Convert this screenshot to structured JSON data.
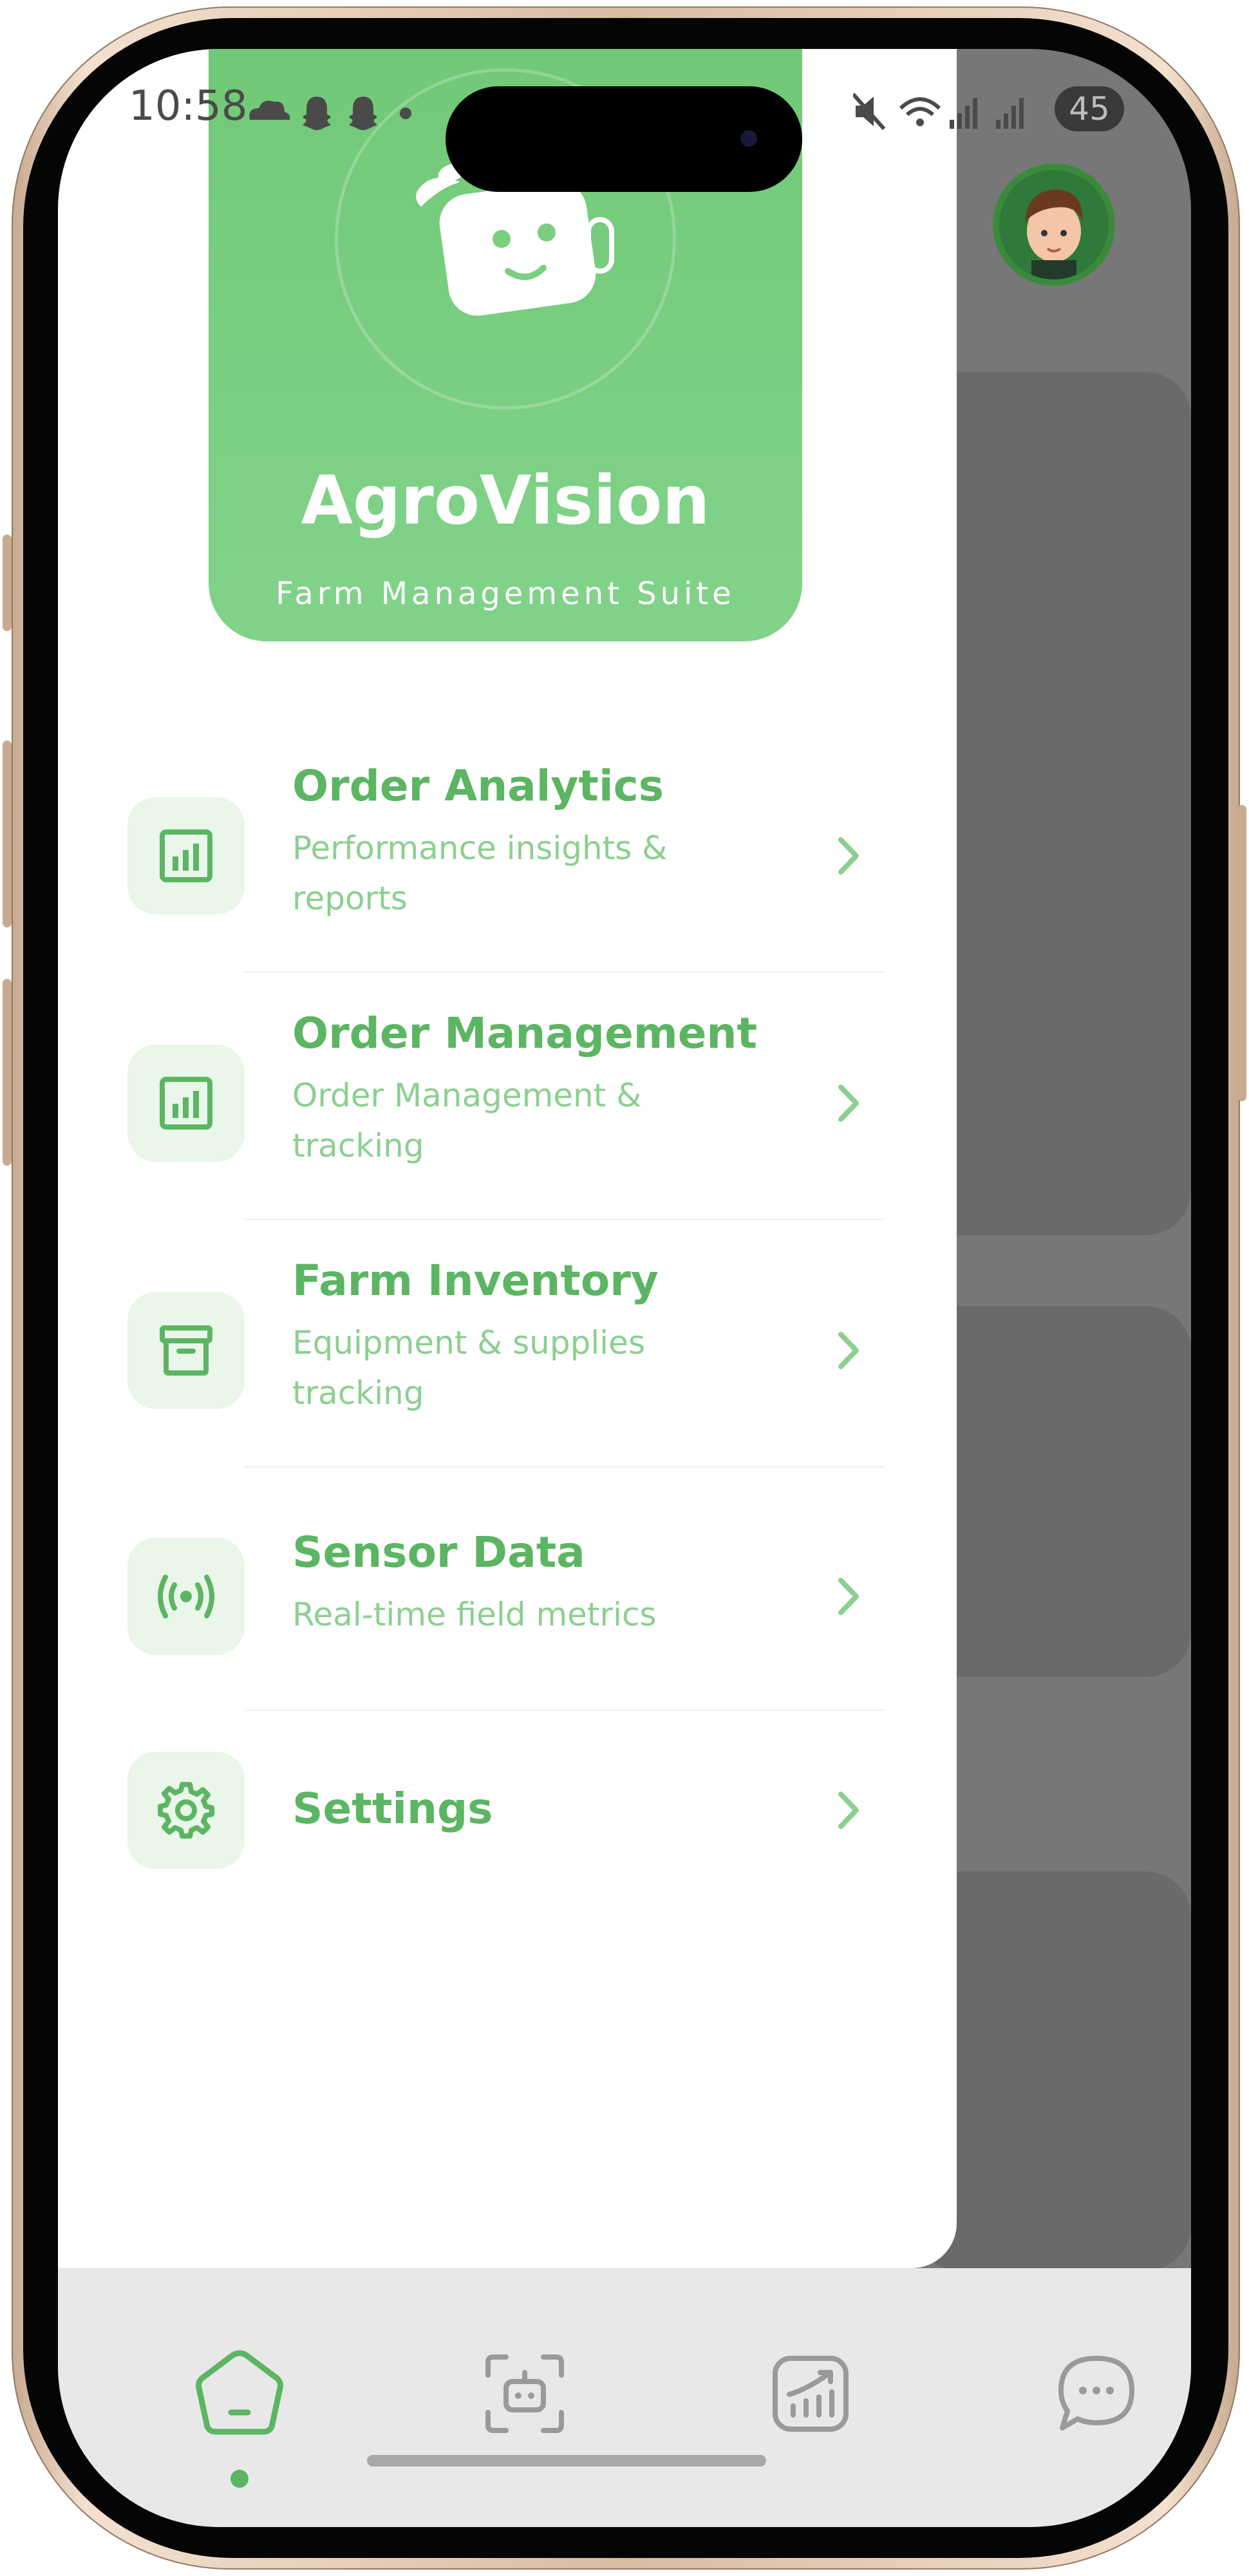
{
  "status_bar": {
    "time": "10:58",
    "battery": "45",
    "icons": [
      "cloud-icon",
      "snapchat-icon",
      "snapchat-icon",
      "dot-icon",
      "mute-icon",
      "wifi-icon",
      "signal-icon",
      "signal-icon"
    ]
  },
  "brand": {
    "title": "AgroVision",
    "subtitle": "Farm Management Suite",
    "logo_icon": "robot-leaf-icon"
  },
  "menu": {
    "items": [
      {
        "title": "Order Analytics",
        "desc_line1": "Performance insights &",
        "desc_line2": "reports",
        "icon": "bar-chart-icon"
      },
      {
        "title": "Order Management",
        "desc_line1": "Order Management &",
        "desc_line2": "tracking",
        "icon": "bar-chart-icon"
      },
      {
        "title": "Farm Inventory",
        "desc_line1": "Equipment & supplies",
        "desc_line2": "tracking",
        "icon": "archive-box-icon"
      },
      {
        "title": "Sensor Data",
        "desc_line1": "Real-time field metrics",
        "desc_line2": "",
        "icon": "broadcast-icon"
      },
      {
        "title": "Settings",
        "desc_line1": "",
        "desc_line2": "",
        "icon": "gear-icon"
      }
    ]
  },
  "bottom_nav": {
    "items": [
      {
        "name": "home",
        "icon": "home-icon",
        "active": true
      },
      {
        "name": "scan-bot",
        "icon": "scan-robot-icon",
        "active": false
      },
      {
        "name": "analytics",
        "icon": "chart-up-icon",
        "active": false
      },
      {
        "name": "chat",
        "icon": "chat-bubble-icon",
        "active": false
      }
    ]
  },
  "colors": {
    "accent": "#5cb563",
    "accent_light": "#8ccf90",
    "brand_bg": "#7acf80",
    "icon_bg": "#e9f6e9",
    "overlay": "#777777"
  }
}
